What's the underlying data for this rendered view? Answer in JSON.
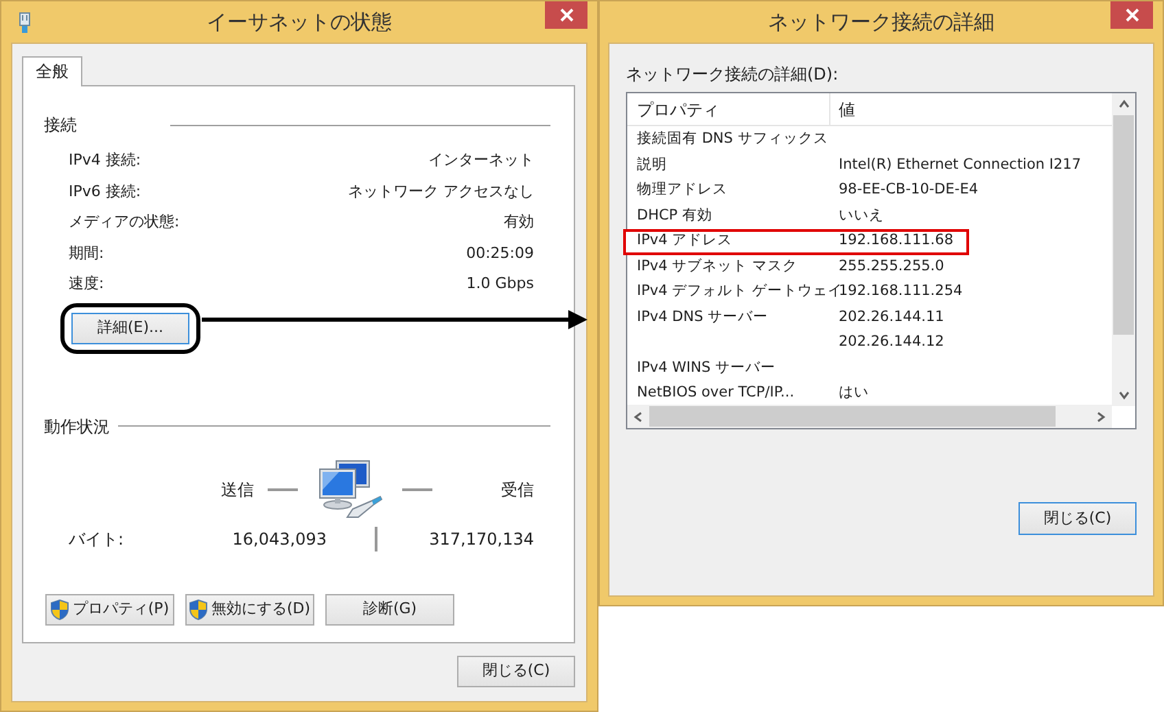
{
  "status_window": {
    "title": "イーサネットの状態",
    "tabs": [
      {
        "label": "全般",
        "selected": true
      }
    ],
    "connection": {
      "heading": "接続",
      "rows": [
        {
          "label": "IPv4 接続:",
          "value": "インターネット"
        },
        {
          "label": "IPv6 接続:",
          "value": "ネットワーク アクセスなし"
        },
        {
          "label": "メディアの状態:",
          "value": "有効"
        },
        {
          "label": "期間:",
          "value": "00:25:09"
        },
        {
          "label": "速度:",
          "value": "1.0 Gbps"
        }
      ]
    },
    "details_button": {
      "label": "詳細(E)...",
      "circled": true
    },
    "activity": {
      "heading": "動作状況",
      "sent_label": "送信",
      "received_label": "受信",
      "bytes_label": "バイト:",
      "sent": "16,043,093",
      "received": "317,170,134"
    },
    "buttons": [
      {
        "label": "プロパティ(P)",
        "kind": "shield"
      },
      {
        "label": "無効にする(D)",
        "kind": "shield"
      },
      {
        "label": "診断(G)",
        "kind": "plain"
      }
    ],
    "close_button": "閉じる(C)"
  },
  "arrow_to_details": true,
  "details_window": {
    "title": "ネットワーク接続の詳細",
    "list_label": "ネットワーク接続の詳細(D):",
    "columns": [
      "プロパティ",
      "値"
    ],
    "rows": [
      {
        "property": "接続固有 DNS サフィックス",
        "highlighted": false
      },
      {
        "property": "説明",
        "value": "Intel(R) Ethernet Connection I217",
        "highlighted": false
      },
      {
        "property": "物理アドレス",
        "value": "98-EE-CB-10-DE-E4",
        "highlighted": false
      },
      {
        "property": "DHCP 有効",
        "value": "いいえ",
        "highlighted": false
      },
      {
        "property": "IPv4 アドレス",
        "value": "192.168.111.68",
        "highlighted": true
      },
      {
        "property": "IPv4 サブネット マスク",
        "value": "255.255.255.0",
        "highlighted": false
      },
      {
        "property": "IPv4 デフォルト ゲートウェイ",
        "value": "192.168.111.254",
        "highlighted": false
      },
      {
        "property": "IPv4 DNS サーバー",
        "value": "202.26.144.11",
        "highlighted": false
      },
      {
        "value": "202.26.144.12",
        "highlighted": false
      },
      {
        "property": "IPv4 WINS サーバー",
        "highlighted": false
      },
      {
        "property": "NetBIOS over TCP/IP...",
        "value": "はい",
        "highlighted": false
      }
    ],
    "close_button": {
      "label": "閉じる(C)",
      "focused": true
    }
  }
}
